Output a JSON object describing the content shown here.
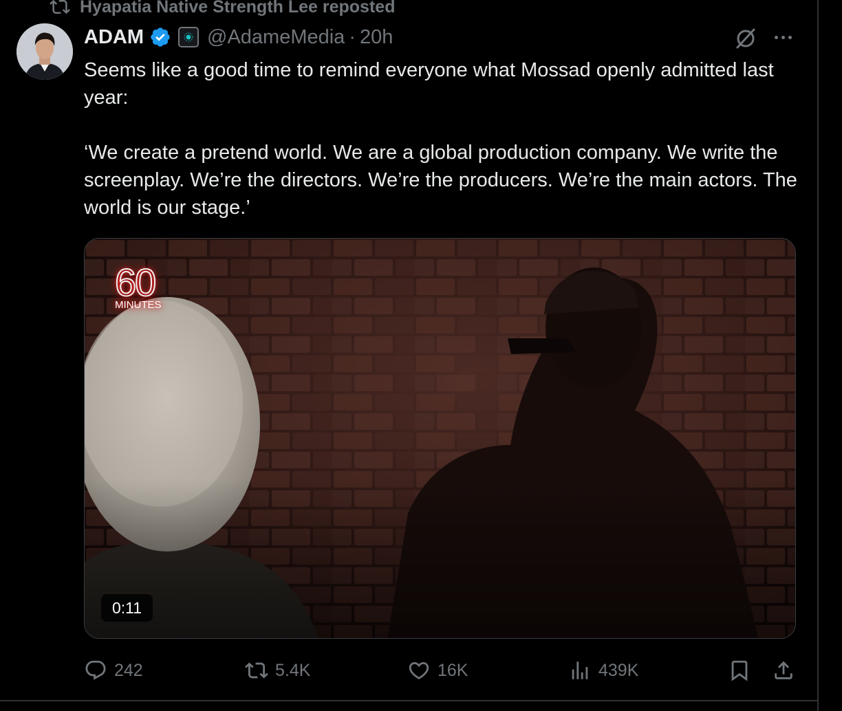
{
  "repost": {
    "text": "Hyapatia Native Strength Lee reposted",
    "icon": "repost-icon"
  },
  "tweet": {
    "name": "ADAM",
    "handle": "@AdameMedia",
    "separator": "·",
    "time": "20h",
    "text_paragraphs": [
      "Seems like a good time to remind everyone what Mossad openly admitted last year:",
      "‘We create a pretend world. We are a global production company. We write the screenplay. We’re the directors. We’re the producers. We’re the main actors. The world is our stage.’"
    ]
  },
  "media": {
    "logo_number": "60",
    "logo_word": "MINUTES",
    "duration": "0:11"
  },
  "actions": {
    "replies": "242",
    "reposts": "5.4K",
    "likes": "16K",
    "views": "439K"
  },
  "colors": {
    "background": "#000000",
    "text_primary": "#e7e9ea",
    "text_secondary": "#71767b",
    "verified_blue": "#1d9bf0",
    "border": "#2f3336"
  }
}
